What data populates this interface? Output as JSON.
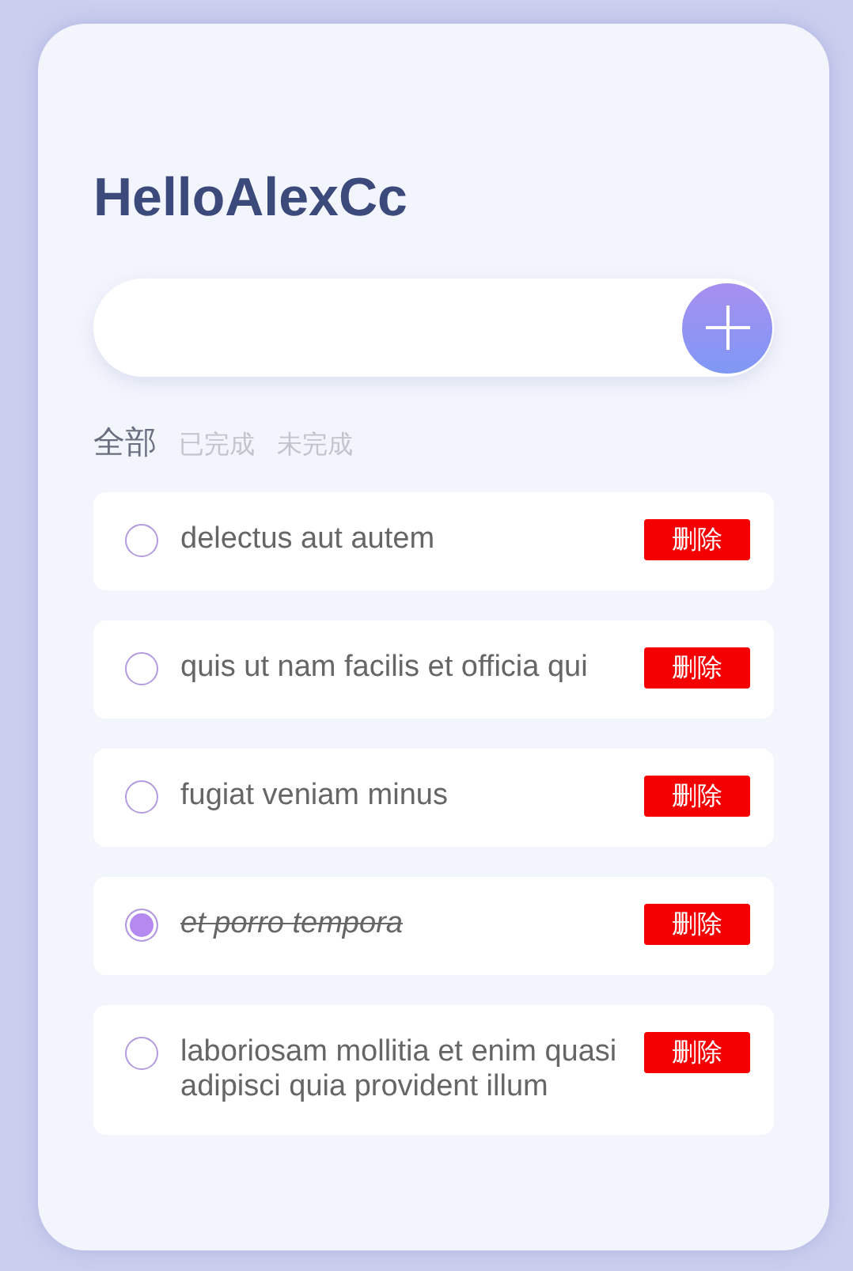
{
  "title": "HelloAlexCc",
  "filters": [
    {
      "label": "全部",
      "selected": true
    },
    {
      "label": "已完成",
      "selected": false
    },
    {
      "label": "未完成",
      "selected": false
    }
  ],
  "todos": [
    {
      "text": "delectus aut autem",
      "checked": false,
      "delete_label": "删除"
    },
    {
      "text": "quis ut nam facilis et officia qui",
      "checked": false,
      "delete_label": "删除"
    },
    {
      "text": "fugiat veniam minus",
      "checked": false,
      "delete_label": "删除"
    },
    {
      "text": "et porro tempora",
      "checked": true,
      "delete_label": "删除"
    },
    {
      "text": "laboriosam mollitia et enim quasi adipisci quia provident illum",
      "checked": false,
      "delete_label": "删除"
    }
  ]
}
